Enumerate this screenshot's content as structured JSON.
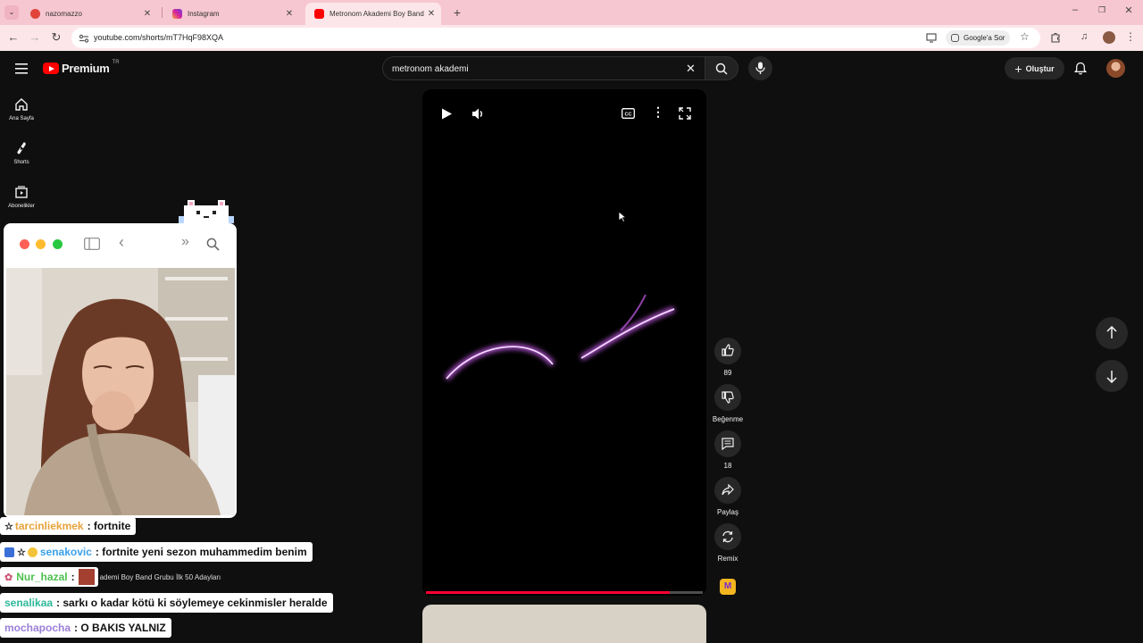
{
  "browser": {
    "tabs": [
      {
        "label": "nazomazzo",
        "active": false,
        "favicon_color": "#e0443a"
      },
      {
        "label": "Instagram",
        "active": false,
        "favicon_color": "#d6249f"
      },
      {
        "label": "Metronom Akademi Boy Band",
        "active": true,
        "favicon_color": "#ff0000"
      }
    ],
    "url": "youtube.com/shorts/mT7HqF98XQA",
    "google_lens_label": "Google'a Sor"
  },
  "youtube": {
    "logo_text": "Premium",
    "region": "TR",
    "search_value": "metronom akademi",
    "create_label": "Oluştur",
    "sidebar": [
      {
        "label": "Ana Sayfa",
        "icon": "home-icon"
      },
      {
        "label": "Shorts",
        "icon": "shorts-icon"
      },
      {
        "label": "Abonelikler",
        "icon": "subscriptions-icon"
      }
    ],
    "actions": {
      "like_count": "89",
      "dislike_label": "Beğenme",
      "comment_count": "18",
      "share_label": "Paylaş",
      "remix_label": "Remix"
    },
    "video_progress": 0.88
  },
  "chat": [
    {
      "user": "tarcinliekmek",
      "user_color": "#e8a23a",
      "message": ": fortnite"
    },
    {
      "user": "senakovic",
      "user_color": "#3aa0e8",
      "message": ": fortnite yeni sezon muhammedim benim"
    },
    {
      "user": "Nur_hazal",
      "user_color": "#4fc04f",
      "message": ":"
    },
    {
      "user": "senalikaa",
      "user_color": "#2fb89a",
      "message": ": sarkı o kadar kötü ki söylemeye cekinmisler heralde"
    },
    {
      "user": "mochapocha",
      "user_color": "#9b7fd8",
      "message": ": O BAKIS YALNIZ"
    }
  ],
  "chat_link_preview": "ademi Boy Band Grubu İlk 50 Adayları",
  "colors": {
    "tab_strip": "#f6c7d0",
    "address_row": "#fde6ea",
    "youtube_bg": "#0f0f0f",
    "progress": "#ff0033"
  }
}
